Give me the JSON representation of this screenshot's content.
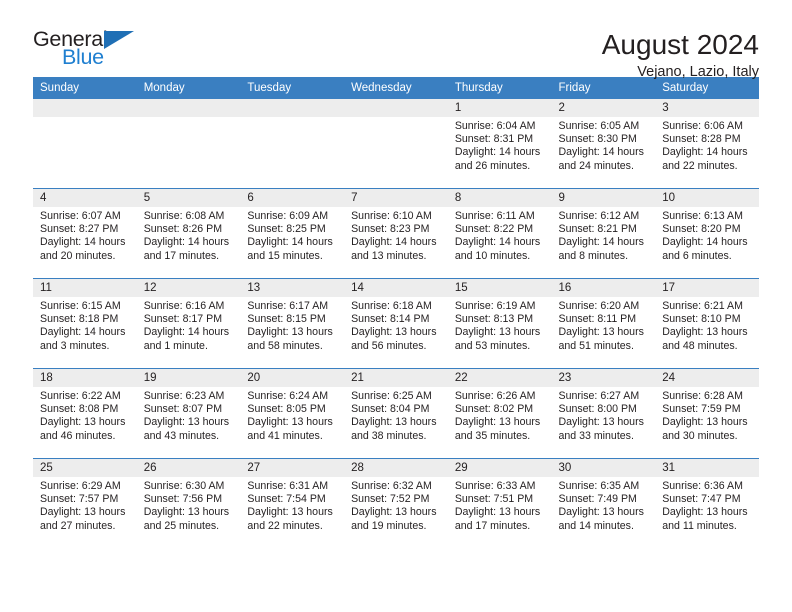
{
  "brand": {
    "name_part1": "General",
    "name_part2": "Blue",
    "triangle_color": "#1f6fb5",
    "blue_color": "#1f7fd0"
  },
  "header": {
    "title": "August 2024",
    "location": "Vejano, Lazio, Italy"
  },
  "theme": {
    "header_blue": "#3a7fc1",
    "daynum_gray": "#ededed",
    "text": "#231f20"
  },
  "weekdays": [
    "Sunday",
    "Monday",
    "Tuesday",
    "Wednesday",
    "Thursday",
    "Friday",
    "Saturday"
  ],
  "weeks": [
    [
      {
        "day": "",
        "sunrise": "",
        "sunset": "",
        "daylight_line1": "",
        "daylight_line2": ""
      },
      {
        "day": "",
        "sunrise": "",
        "sunset": "",
        "daylight_line1": "",
        "daylight_line2": ""
      },
      {
        "day": "",
        "sunrise": "",
        "sunset": "",
        "daylight_line1": "",
        "daylight_line2": ""
      },
      {
        "day": "",
        "sunrise": "",
        "sunset": "",
        "daylight_line1": "",
        "daylight_line2": ""
      },
      {
        "day": "1",
        "sunrise": "Sunrise: 6:04 AM",
        "sunset": "Sunset: 8:31 PM",
        "daylight_line1": "Daylight: 14 hours",
        "daylight_line2": "and 26 minutes."
      },
      {
        "day": "2",
        "sunrise": "Sunrise: 6:05 AM",
        "sunset": "Sunset: 8:30 PM",
        "daylight_line1": "Daylight: 14 hours",
        "daylight_line2": "and 24 minutes."
      },
      {
        "day": "3",
        "sunrise": "Sunrise: 6:06 AM",
        "sunset": "Sunset: 8:28 PM",
        "daylight_line1": "Daylight: 14 hours",
        "daylight_line2": "and 22 minutes."
      }
    ],
    [
      {
        "day": "4",
        "sunrise": "Sunrise: 6:07 AM",
        "sunset": "Sunset: 8:27 PM",
        "daylight_line1": "Daylight: 14 hours",
        "daylight_line2": "and 20 minutes."
      },
      {
        "day": "5",
        "sunrise": "Sunrise: 6:08 AM",
        "sunset": "Sunset: 8:26 PM",
        "daylight_line1": "Daylight: 14 hours",
        "daylight_line2": "and 17 minutes."
      },
      {
        "day": "6",
        "sunrise": "Sunrise: 6:09 AM",
        "sunset": "Sunset: 8:25 PM",
        "daylight_line1": "Daylight: 14 hours",
        "daylight_line2": "and 15 minutes."
      },
      {
        "day": "7",
        "sunrise": "Sunrise: 6:10 AM",
        "sunset": "Sunset: 8:23 PM",
        "daylight_line1": "Daylight: 14 hours",
        "daylight_line2": "and 13 minutes."
      },
      {
        "day": "8",
        "sunrise": "Sunrise: 6:11 AM",
        "sunset": "Sunset: 8:22 PM",
        "daylight_line1": "Daylight: 14 hours",
        "daylight_line2": "and 10 minutes."
      },
      {
        "day": "9",
        "sunrise": "Sunrise: 6:12 AM",
        "sunset": "Sunset: 8:21 PM",
        "daylight_line1": "Daylight: 14 hours",
        "daylight_line2": "and 8 minutes."
      },
      {
        "day": "10",
        "sunrise": "Sunrise: 6:13 AM",
        "sunset": "Sunset: 8:20 PM",
        "daylight_line1": "Daylight: 14 hours",
        "daylight_line2": "and 6 minutes."
      }
    ],
    [
      {
        "day": "11",
        "sunrise": "Sunrise: 6:15 AM",
        "sunset": "Sunset: 8:18 PM",
        "daylight_line1": "Daylight: 14 hours",
        "daylight_line2": "and 3 minutes."
      },
      {
        "day": "12",
        "sunrise": "Sunrise: 6:16 AM",
        "sunset": "Sunset: 8:17 PM",
        "daylight_line1": "Daylight: 14 hours",
        "daylight_line2": "and 1 minute."
      },
      {
        "day": "13",
        "sunrise": "Sunrise: 6:17 AM",
        "sunset": "Sunset: 8:15 PM",
        "daylight_line1": "Daylight: 13 hours",
        "daylight_line2": "and 58 minutes."
      },
      {
        "day": "14",
        "sunrise": "Sunrise: 6:18 AM",
        "sunset": "Sunset: 8:14 PM",
        "daylight_line1": "Daylight: 13 hours",
        "daylight_line2": "and 56 minutes."
      },
      {
        "day": "15",
        "sunrise": "Sunrise: 6:19 AM",
        "sunset": "Sunset: 8:13 PM",
        "daylight_line1": "Daylight: 13 hours",
        "daylight_line2": "and 53 minutes."
      },
      {
        "day": "16",
        "sunrise": "Sunrise: 6:20 AM",
        "sunset": "Sunset: 8:11 PM",
        "daylight_line1": "Daylight: 13 hours",
        "daylight_line2": "and 51 minutes."
      },
      {
        "day": "17",
        "sunrise": "Sunrise: 6:21 AM",
        "sunset": "Sunset: 8:10 PM",
        "daylight_line1": "Daylight: 13 hours",
        "daylight_line2": "and 48 minutes."
      }
    ],
    [
      {
        "day": "18",
        "sunrise": "Sunrise: 6:22 AM",
        "sunset": "Sunset: 8:08 PM",
        "daylight_line1": "Daylight: 13 hours",
        "daylight_line2": "and 46 minutes."
      },
      {
        "day": "19",
        "sunrise": "Sunrise: 6:23 AM",
        "sunset": "Sunset: 8:07 PM",
        "daylight_line1": "Daylight: 13 hours",
        "daylight_line2": "and 43 minutes."
      },
      {
        "day": "20",
        "sunrise": "Sunrise: 6:24 AM",
        "sunset": "Sunset: 8:05 PM",
        "daylight_line1": "Daylight: 13 hours",
        "daylight_line2": "and 41 minutes."
      },
      {
        "day": "21",
        "sunrise": "Sunrise: 6:25 AM",
        "sunset": "Sunset: 8:04 PM",
        "daylight_line1": "Daylight: 13 hours",
        "daylight_line2": "and 38 minutes."
      },
      {
        "day": "22",
        "sunrise": "Sunrise: 6:26 AM",
        "sunset": "Sunset: 8:02 PM",
        "daylight_line1": "Daylight: 13 hours",
        "daylight_line2": "and 35 minutes."
      },
      {
        "day": "23",
        "sunrise": "Sunrise: 6:27 AM",
        "sunset": "Sunset: 8:00 PM",
        "daylight_line1": "Daylight: 13 hours",
        "daylight_line2": "and 33 minutes."
      },
      {
        "day": "24",
        "sunrise": "Sunrise: 6:28 AM",
        "sunset": "Sunset: 7:59 PM",
        "daylight_line1": "Daylight: 13 hours",
        "daylight_line2": "and 30 minutes."
      }
    ],
    [
      {
        "day": "25",
        "sunrise": "Sunrise: 6:29 AM",
        "sunset": "Sunset: 7:57 PM",
        "daylight_line1": "Daylight: 13 hours",
        "daylight_line2": "and 27 minutes."
      },
      {
        "day": "26",
        "sunrise": "Sunrise: 6:30 AM",
        "sunset": "Sunset: 7:56 PM",
        "daylight_line1": "Daylight: 13 hours",
        "daylight_line2": "and 25 minutes."
      },
      {
        "day": "27",
        "sunrise": "Sunrise: 6:31 AM",
        "sunset": "Sunset: 7:54 PM",
        "daylight_line1": "Daylight: 13 hours",
        "daylight_line2": "and 22 minutes."
      },
      {
        "day": "28",
        "sunrise": "Sunrise: 6:32 AM",
        "sunset": "Sunset: 7:52 PM",
        "daylight_line1": "Daylight: 13 hours",
        "daylight_line2": "and 19 minutes."
      },
      {
        "day": "29",
        "sunrise": "Sunrise: 6:33 AM",
        "sunset": "Sunset: 7:51 PM",
        "daylight_line1": "Daylight: 13 hours",
        "daylight_line2": "and 17 minutes."
      },
      {
        "day": "30",
        "sunrise": "Sunrise: 6:35 AM",
        "sunset": "Sunset: 7:49 PM",
        "daylight_line1": "Daylight: 13 hours",
        "daylight_line2": "and 14 minutes."
      },
      {
        "day": "31",
        "sunrise": "Sunrise: 6:36 AM",
        "sunset": "Sunset: 7:47 PM",
        "daylight_line1": "Daylight: 13 hours",
        "daylight_line2": "and 11 minutes."
      }
    ]
  ]
}
